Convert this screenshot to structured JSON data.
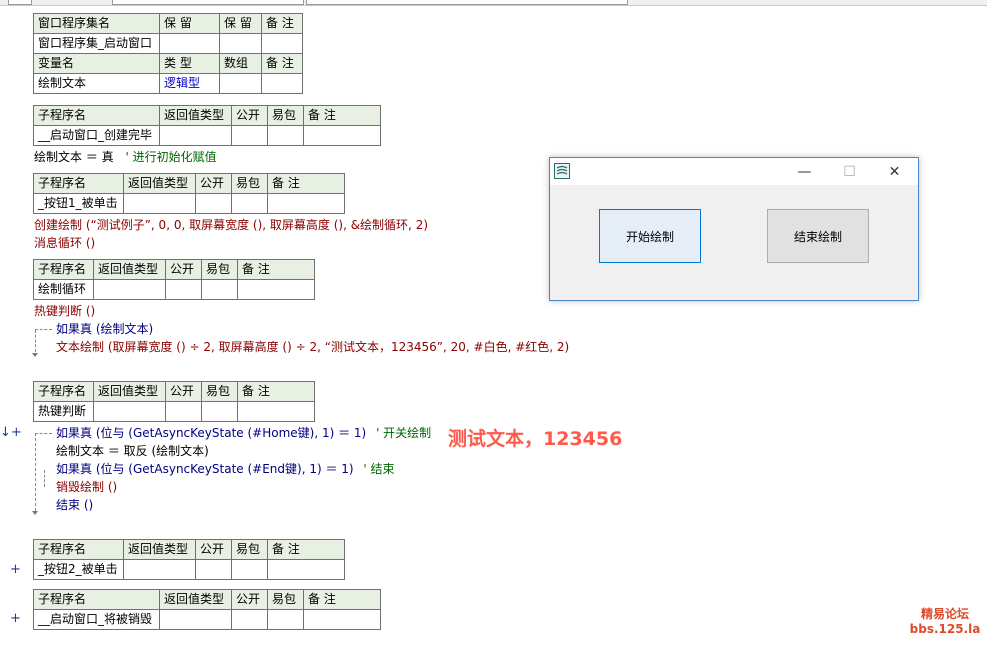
{
  "t1": {
    "r1": [
      "窗口程序集名",
      "保 留",
      "保 留",
      "备 注"
    ],
    "r2": [
      "窗口程序集_启动窗口",
      "",
      "",
      ""
    ],
    "r3": [
      "变量名",
      "类 型",
      "数组",
      "备 注"
    ],
    "r4": [
      "绘制文本",
      "逻辑型",
      "",
      ""
    ]
  },
  "sub_header": [
    "子程序名",
    "返回值类型",
    "公开",
    "易包",
    "备 注"
  ],
  "subs": {
    "s1": "__启动窗口_创建完毕",
    "s2": "_按钮1_被单击",
    "s3": "绘制循环",
    "s4": "热键判断",
    "s5": "_按钮2_被单击",
    "s6": "__启动窗口_将被销毁"
  },
  "code": {
    "l1a": "绘制文本 ＝ 真",
    "l1b": "' 进行初始化赋值",
    "l2": "创建绘制 (“测试例子”, 0, 0, 取屏幕宽度 (), 取屏幕高度 (), &绘制循环, 2)",
    "l3": "消息循环 ()",
    "l4": "热键判断 ()",
    "l5": "如果真 (绘制文本)",
    "l6": "文本绘制 (取屏幕宽度 () ÷ 2, 取屏幕高度 () ÷ 2, “测试文本，123456”, 20, #白色, #红色, 2)",
    "l7a": "如果真 (位与 (GetAsyncKeyState (#Home键), 1) ＝ 1)",
    "l7b": "' 开关绘制",
    "l8": "绘制文本 ＝ 取反 (绘制文本)",
    "l9a": "如果真 (位与 (GetAsyncKeyState (#End键), 1) ＝ 1)",
    "l9b": "' 结束",
    "l10": "销毁绘制 ()",
    "l11": "结束 ()"
  },
  "overlay_text": "测试文本，123456",
  "win": {
    "btn1": "开始绘制",
    "btn2": "结束绘制",
    "min_glyph": "—",
    "max_glyph": "☐",
    "close_glyph": "✕"
  },
  "watermark": {
    "line1": "精易论坛",
    "line2": "bbs.125.la"
  },
  "gutter": {
    "plus": "+",
    "arrow_plus": "↓+"
  },
  "colors": {
    "header_bg": "#e7f0e2",
    "overlay": "#ff5a4a",
    "keyword_red": "#8b0000",
    "type_blue": "#0000cc"
  }
}
